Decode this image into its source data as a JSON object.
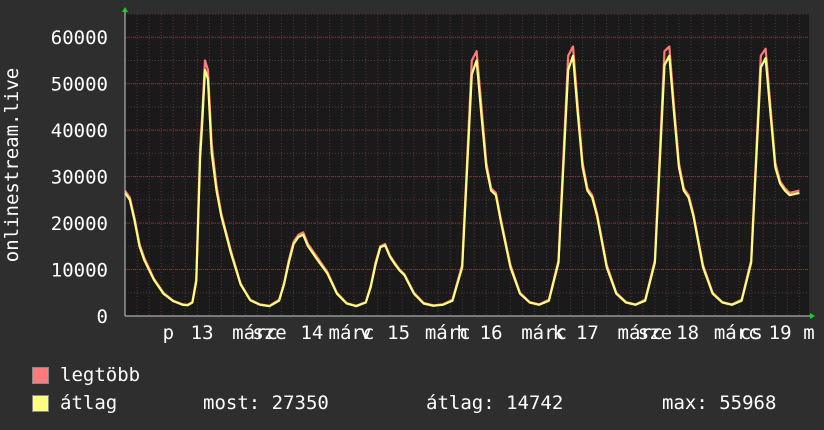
{
  "chart_data": {
    "type": "line",
    "ylabel": "onlinestream.live",
    "ylim": [
      0,
      65000
    ],
    "y_ticks": [
      0,
      10000,
      20000,
      30000,
      40000,
      50000,
      60000
    ],
    "y_tick_labels": [
      "0",
      "10000",
      "20000",
      "30000",
      "40000",
      "50000",
      "60000"
    ],
    "x_range": [
      0,
      7.1
    ],
    "x_ticks": [
      {
        "x": 0.45,
        "label": "p"
      },
      {
        "x": 0.8,
        "label": "13"
      },
      {
        "x": 1.35,
        "label": "márc"
      },
      {
        "x": 1.5,
        "label": "sze"
      },
      {
        "x": 1.94,
        "label": "14"
      },
      {
        "x": 2.35,
        "label": "márc"
      },
      {
        "x": 2.5,
        "label": "v"
      },
      {
        "x": 2.84,
        "label": "15"
      },
      {
        "x": 3.35,
        "label": "márc"
      },
      {
        "x": 3.5,
        "label": "h"
      },
      {
        "x": 3.8,
        "label": "16"
      },
      {
        "x": 4.35,
        "label": "márc"
      },
      {
        "x": 4.5,
        "label": "k"
      },
      {
        "x": 4.8,
        "label": "17"
      },
      {
        "x": 5.35,
        "label": "márc"
      },
      {
        "x": 5.5,
        "label": "sze"
      },
      {
        "x": 5.84,
        "label": "18"
      },
      {
        "x": 6.35,
        "label": "márc"
      },
      {
        "x": 6.5,
        "label": "cs"
      },
      {
        "x": 6.8,
        "label": "19"
      },
      {
        "x": 7.1,
        "label": "m"
      }
    ],
    "grid": true,
    "colors": {
      "background": "#2e2e2e",
      "plot_bg": "#1a1a1a",
      "grid": "#5a3535",
      "axis": "#cccccc",
      "legtobb": "#ff7a7a",
      "atlag": "#ffff80"
    },
    "series": [
      {
        "name": "legtöbb",
        "color": "#ff7a7a",
        "x": [
          0,
          0.05,
          0.1,
          0.15,
          0.2,
          0.3,
          0.4,
          0.5,
          0.6,
          0.65,
          0.7,
          0.74,
          0.78,
          0.8,
          0.83,
          0.86,
          0.9,
          0.95,
          1.0,
          1.1,
          1.2,
          1.3,
          1.4,
          1.5,
          1.6,
          1.65,
          1.7,
          1.75,
          1.8,
          1.85,
          1.9,
          1.95,
          2.0,
          2.1,
          2.2,
          2.3,
          2.4,
          2.5,
          2.55,
          2.6,
          2.65,
          2.7,
          2.75,
          2.8,
          2.85,
          2.9,
          3.0,
          3.1,
          3.2,
          3.3,
          3.4,
          3.5,
          3.6,
          3.65,
          3.7,
          3.75,
          3.8,
          3.85,
          3.9,
          4.0,
          4.1,
          4.2,
          4.3,
          4.4,
          4.5,
          4.6,
          4.65,
          4.7,
          4.75,
          4.8,
          4.85,
          4.9,
          5.0,
          5.1,
          5.2,
          5.3,
          5.4,
          5.5,
          5.6,
          5.65,
          5.7,
          5.75,
          5.8,
          5.85,
          5.9,
          6.0,
          6.1,
          6.2,
          6.3,
          6.4,
          6.5,
          6.6,
          6.65,
          6.7,
          6.75,
          6.8,
          6.85,
          6.9,
          7.0
        ],
        "values": [
          27000,
          25500,
          21000,
          15500,
          12500,
          8000,
          5000,
          3300,
          2500,
          2400,
          3000,
          8000,
          36000,
          43000,
          55000,
          53000,
          37000,
          28000,
          22000,
          14000,
          7000,
          3500,
          2500,
          2200,
          3500,
          7000,
          12000,
          16000,
          17500,
          18000,
          15500,
          14000,
          12500,
          9500,
          5000,
          2800,
          2200,
          3000,
          6500,
          11500,
          15000,
          15500,
          13000,
          11500,
          10000,
          9000,
          5000,
          2800,
          2300,
          2500,
          3500,
          11000,
          55000,
          57000,
          45000,
          33000,
          27500,
          26500,
          21000,
          11000,
          5000,
          3000,
          2500,
          3500,
          12000,
          56000,
          58000,
          45000,
          33000,
          27500,
          26000,
          22000,
          11000,
          5000,
          3000,
          2500,
          3500,
          12000,
          57000,
          58000,
          45000,
          33000,
          27500,
          26000,
          22000,
          11000,
          5000,
          3000,
          2500,
          3500,
          12000,
          56000,
          57500,
          45000,
          33000,
          29000,
          27500,
          26500,
          27000
        ]
      },
      {
        "name": "átlag",
        "color": "#ffff80",
        "x": [
          0,
          0.05,
          0.1,
          0.15,
          0.2,
          0.3,
          0.4,
          0.5,
          0.6,
          0.65,
          0.7,
          0.74,
          0.78,
          0.8,
          0.83,
          0.86,
          0.9,
          0.95,
          1.0,
          1.1,
          1.2,
          1.3,
          1.4,
          1.5,
          1.6,
          1.65,
          1.7,
          1.75,
          1.8,
          1.85,
          1.9,
          1.95,
          2.0,
          2.1,
          2.2,
          2.3,
          2.4,
          2.5,
          2.55,
          2.6,
          2.65,
          2.7,
          2.75,
          2.8,
          2.85,
          2.9,
          3.0,
          3.1,
          3.2,
          3.3,
          3.4,
          3.5,
          3.6,
          3.65,
          3.7,
          3.75,
          3.8,
          3.85,
          3.9,
          4.0,
          4.1,
          4.2,
          4.3,
          4.4,
          4.5,
          4.6,
          4.65,
          4.7,
          4.75,
          4.8,
          4.85,
          4.9,
          5.0,
          5.1,
          5.2,
          5.3,
          5.4,
          5.5,
          5.6,
          5.65,
          5.7,
          5.75,
          5.8,
          5.85,
          5.9,
          6.0,
          6.1,
          6.2,
          6.3,
          6.4,
          6.5,
          6.6,
          6.65,
          6.7,
          6.75,
          6.8,
          6.85,
          6.9,
          7.0
        ],
        "values": [
          26500,
          25000,
          20500,
          15000,
          12000,
          7800,
          4800,
          3200,
          2400,
          2300,
          2900,
          7500,
          34000,
          41000,
          53000,
          51000,
          35000,
          27000,
          21500,
          13500,
          6800,
          3400,
          2400,
          2100,
          3300,
          6800,
          11500,
          15500,
          17000,
          17500,
          15000,
          13500,
          12000,
          9200,
          4800,
          2700,
          2100,
          2900,
          6200,
          11000,
          14800,
          15200,
          12800,
          11200,
          9800,
          8800,
          4800,
          2700,
          2200,
          2400,
          3300,
          10500,
          52000,
          55000,
          43000,
          32000,
          27000,
          26000,
          20500,
          10500,
          4800,
          2900,
          2400,
          3300,
          11500,
          53000,
          56000,
          43500,
          32000,
          27000,
          25500,
          21500,
          10500,
          4800,
          2900,
          2400,
          3300,
          11500,
          54000,
          56000,
          43500,
          32000,
          27000,
          25500,
          21500,
          10500,
          4800,
          2900,
          2400,
          3300,
          11500,
          53500,
          55500,
          43500,
          32000,
          28500,
          27000,
          26000,
          26500
        ]
      }
    ]
  },
  "legend": {
    "items": [
      {
        "label": "legtöbb",
        "color": "#ff7a7a"
      },
      {
        "label": "átlag",
        "color": "#ffff80"
      }
    ],
    "stats": {
      "most": "most: 27350",
      "atlag": "átlag: 14742",
      "max": "max: 55968"
    }
  }
}
